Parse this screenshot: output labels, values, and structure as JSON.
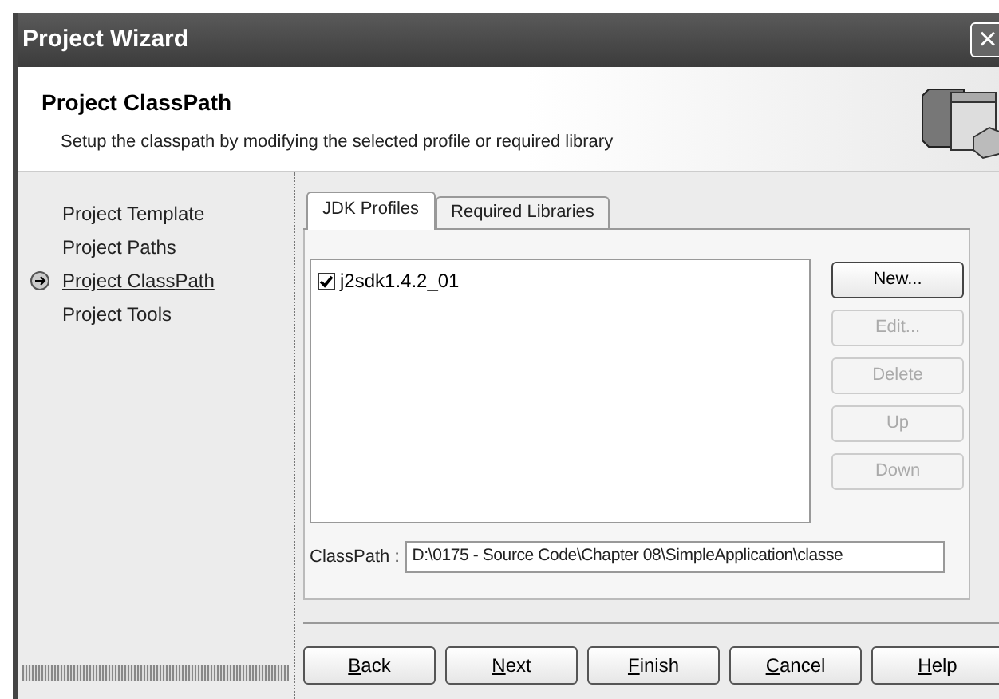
{
  "window": {
    "title": "Project Wizard",
    "close": "×"
  },
  "header": {
    "title": "Project ClassPath",
    "subtitle": "Setup the classpath by modifying the selected profile or required library"
  },
  "steps": [
    {
      "label": "Project Template",
      "selected": false
    },
    {
      "label": "Project Paths",
      "selected": false
    },
    {
      "label": "Project ClassPath",
      "selected": true
    },
    {
      "label": "Project Tools",
      "selected": false
    }
  ],
  "tabs": [
    {
      "label": "JDK Profiles",
      "selected": true
    },
    {
      "label": "Required Libraries",
      "selected": false
    }
  ],
  "profiles": [
    {
      "label": "j2sdk1.4.2_01",
      "checked": true
    }
  ],
  "side_buttons": [
    {
      "label": "New...",
      "disabled": false
    },
    {
      "label": "Edit...",
      "disabled": true
    },
    {
      "label": "Delete",
      "disabled": true
    },
    {
      "label": "Up",
      "disabled": true
    },
    {
      "label": "Down",
      "disabled": true
    }
  ],
  "classpath": {
    "label": "ClassPath :",
    "value": "D:\\0175 - Source Code\\Chapter 08\\SimpleApplication\\classe"
  },
  "buttons": [
    {
      "mnemonic": "B",
      "rest": "ack"
    },
    {
      "mnemonic": "N",
      "rest": "ext"
    },
    {
      "mnemonic": "F",
      "rest": "inish"
    },
    {
      "mnemonic": "C",
      "rest": "ancel"
    },
    {
      "mnemonic": "H",
      "rest": "elp"
    }
  ]
}
